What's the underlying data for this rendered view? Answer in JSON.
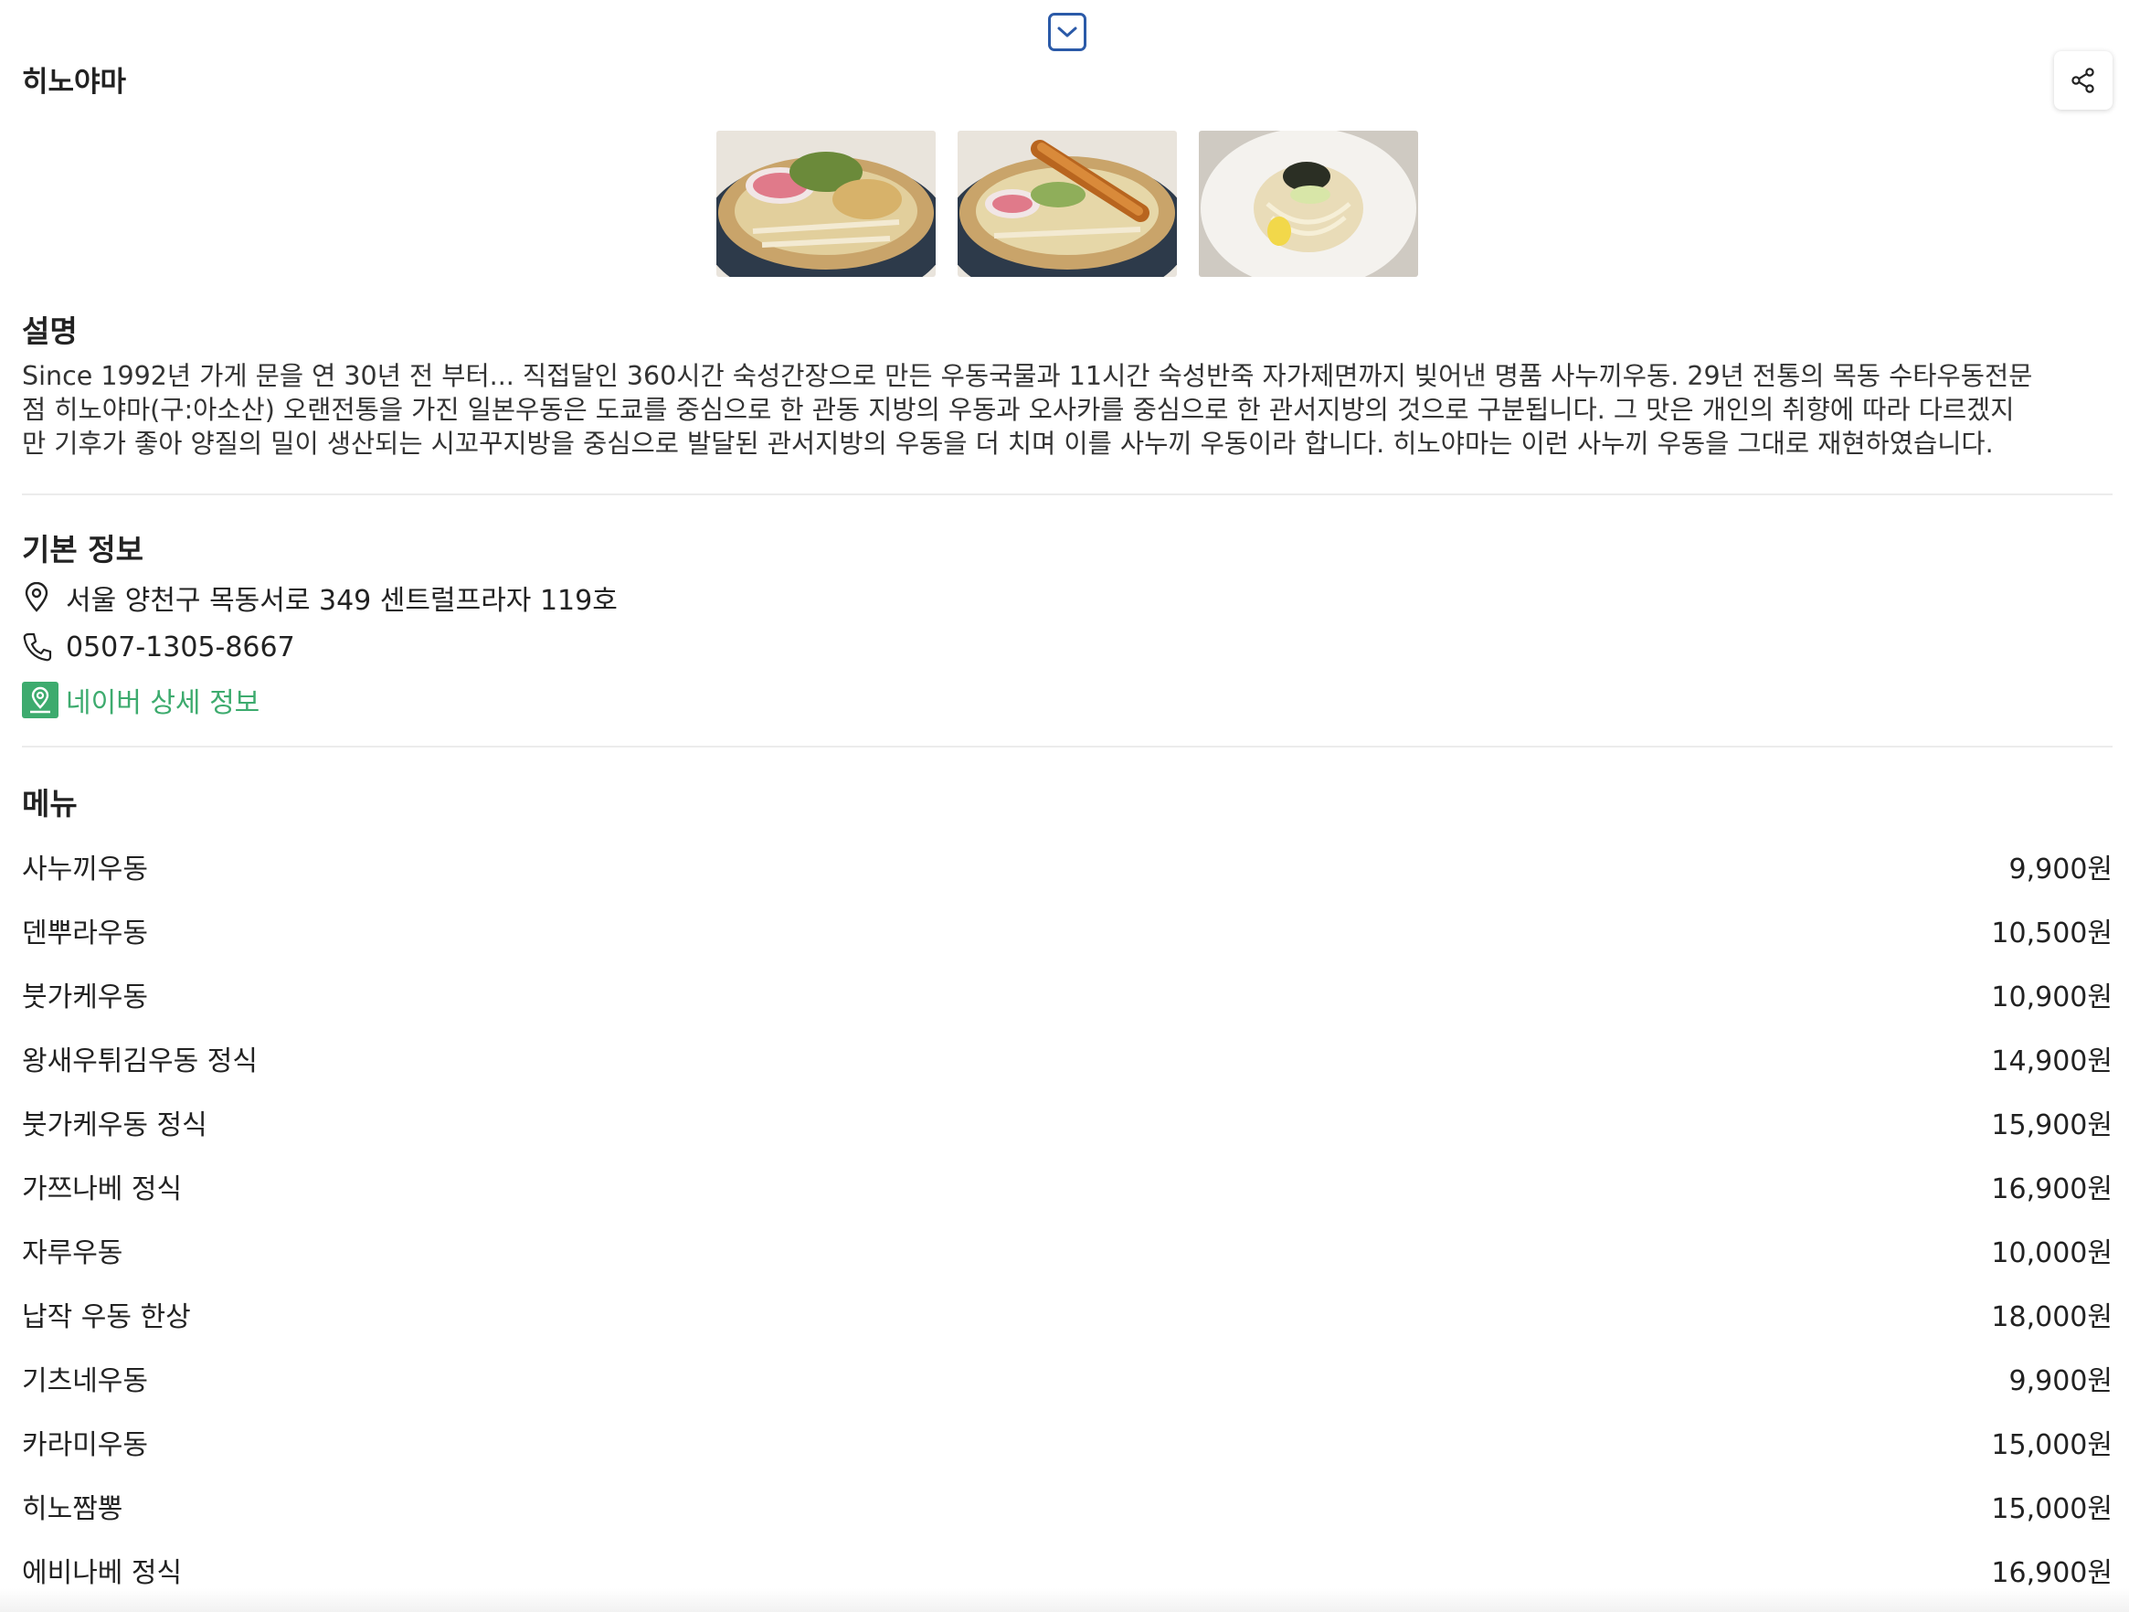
{
  "restaurant": {
    "name": "히노야마"
  },
  "photos": [
    {
      "alt": "udon-1"
    },
    {
      "alt": "udon-2"
    },
    {
      "alt": "udon-3"
    }
  ],
  "description": {
    "heading": "설명",
    "lines": [
      "Since 1992년 가게 문을 연 30년 전 부터... 직접달인 360시간 숙성간장으로 만든 우동국물과 11시간 숙성반죽 자가제면까지 빚어낸 명품 사누끼우동. 29년 전통의 목동 수타우동전문",
      "점 히노야마(구:아소산) 오랜전통을 가진 일본우동은 도쿄를 중심으로 한 관동 지방의 우동과 오사카를 중심으로 한 관서지방의 것으로 구분됩니다. 그 맛은 개인의 취향에 따라 다르겠지",
      "만 기후가 좋아 양질의 밀이 생산되는 시꼬꾸지방을 중심으로 발달된 관서지방의 우동을 더 치며 이를 사누끼 우동이라 합니다. 히노야마는 이런 사누끼 우동을 그대로 재현하였습니다."
    ]
  },
  "basic_info": {
    "heading": "기본 정보",
    "address": "서울 양천구 목동서로 349 센트럴프라자 119호",
    "phone": "0507-1305-8667",
    "naver_link": "네이버 상세 정보"
  },
  "menu": {
    "heading": "메뉴",
    "items": [
      {
        "name": "사누끼우동",
        "price": "9,900원"
      },
      {
        "name": "덴뿌라우동",
        "price": "10,500원"
      },
      {
        "name": "붓가케우동",
        "price": "10,900원"
      },
      {
        "name": "왕새우튀김우동 정식",
        "price": "14,900원"
      },
      {
        "name": "붓가케우동 정식",
        "price": "15,900원"
      },
      {
        "name": "가쯔나베 정식",
        "price": "16,900원"
      },
      {
        "name": "자루우동",
        "price": "10,000원"
      },
      {
        "name": "납작 우동 한상",
        "price": "18,000원"
      },
      {
        "name": "기츠네우동",
        "price": "9,900원"
      },
      {
        "name": "카라미우동",
        "price": "15,000원"
      },
      {
        "name": "히노짬뽕",
        "price": "15,000원"
      },
      {
        "name": "에비나베 정식",
        "price": "16,900원"
      }
    ]
  },
  "colors": {
    "accent_blue": "#2b5aa8",
    "naver_green": "#3dab6e"
  },
  "icons": {
    "collapse": "chevron-down-icon",
    "share": "share-icon",
    "address": "map-pin-icon",
    "phone": "phone-icon",
    "naver": "naver-map-icon"
  }
}
